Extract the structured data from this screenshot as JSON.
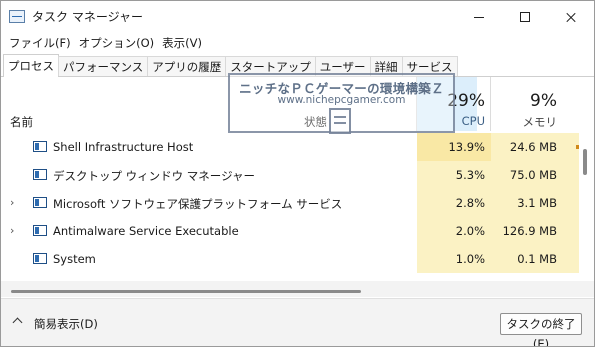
{
  "window": {
    "title": "タスク マネージャー"
  },
  "menubar": {
    "items": [
      "ファイル(F)",
      "オプション(O)",
      "表示(V)"
    ]
  },
  "tabs": [
    "プロセス",
    "パフォーマンス",
    "アプリの履歴",
    "スタートアップ",
    "ユーザー",
    "詳細",
    "サービス"
  ],
  "columns": {
    "name": "名前",
    "status": "状態",
    "sort_indicator": "⌄",
    "cpu": {
      "percent": "29%",
      "label": "CPU"
    },
    "memory": {
      "percent": "9%",
      "label": "メモリ"
    }
  },
  "processes": [
    {
      "name": "Shell Infrastructure Host",
      "cpu": "13.9%",
      "memory": "24.6 MB",
      "expandable": false
    },
    {
      "name": "デスクトップ ウィンドウ マネージャー",
      "cpu": "5.3%",
      "memory": "75.0 MB",
      "expandable": false
    },
    {
      "name": "Microsoft ソフトウェア保護プラットフォーム サービス",
      "cpu": "2.8%",
      "memory": "3.1 MB",
      "expandable": true
    },
    {
      "name": "Antimalware Service Executable",
      "cpu": "2.0%",
      "memory": "126.9 MB",
      "expandable": true
    },
    {
      "name": "System",
      "cpu": "1.0%",
      "memory": "0.1 MB",
      "expandable": false
    }
  ],
  "footer": {
    "fewer_details": "簡易表示(D)",
    "end_task": "タスクの終了(E)"
  },
  "watermark": {
    "title": "ニッチなＰＣゲーマーの環境構築Ｚ",
    "url": "www.nichepcgamer.com"
  },
  "colors": {
    "cpu_header_bg": "#dceefb",
    "heat_low": "#fbf2c4",
    "heat_mid": "#f9e8a5",
    "accent": "#2d6bb0"
  }
}
